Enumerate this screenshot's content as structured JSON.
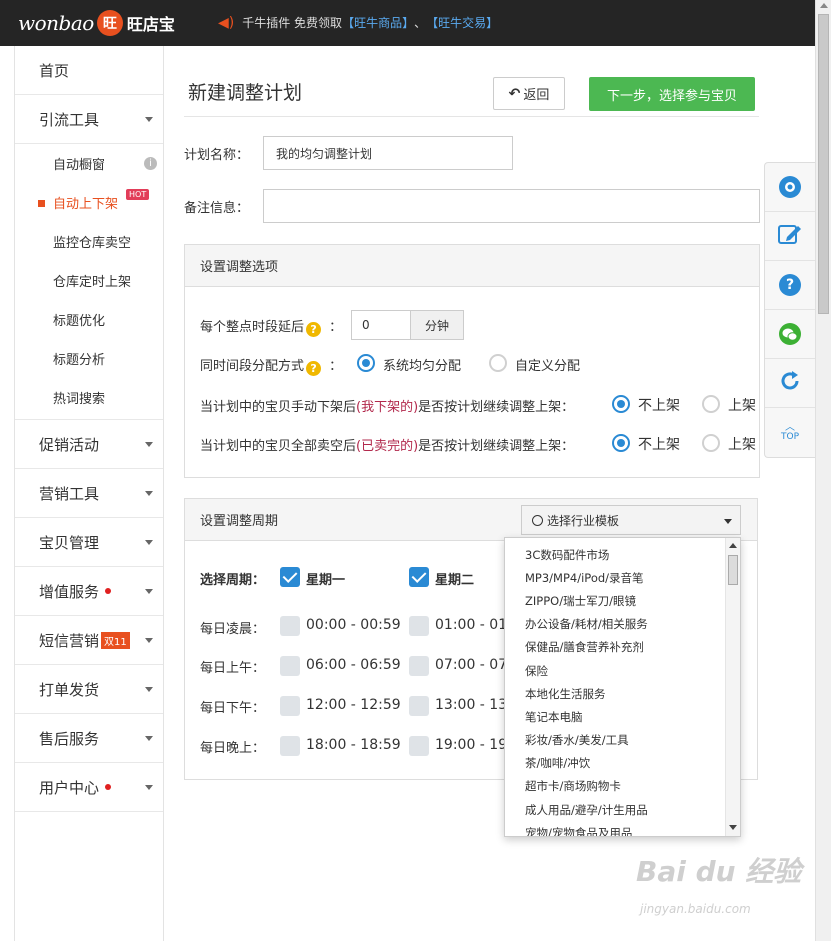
{
  "topbar": {
    "logo_text": "wonbao",
    "logo_badge": "旺",
    "logo_cn": "旺店宝",
    "notice_prefix": "千牛插件 免费领取",
    "link1": "【旺牛商品】",
    "sep": "、",
    "link2": "【旺牛交易】"
  },
  "sidebar": {
    "home": "首页",
    "traffic": "引流工具",
    "sub": [
      "自动橱窗",
      "自动上下架",
      "监控仓库卖空",
      "仓库定时上架",
      "标题优化",
      "标题分析",
      "热词搜索"
    ],
    "hot": "HOT",
    "promo": "促销活动",
    "marketing": "营销工具",
    "items": "宝贝管理",
    "value_added": "增值服务",
    "sms": "短信营销",
    "sms_badge": "双11",
    "print": "打单发货",
    "aftersale": "售后服务",
    "user": "用户中心"
  },
  "main": {
    "title": "新建调整计划",
    "back": "返回",
    "next": "下一步，选择参与宝贝",
    "plan_name_label": "计划名称：",
    "plan_name_value": "我的均匀调整计划",
    "note_label": "备注信息：",
    "note_value": ""
  },
  "options": {
    "head": "设置调整选项",
    "delay_label": "每个整点时段延后",
    "colon": "：",
    "delay_value": "0",
    "delay_unit": "分钟",
    "mode_label": "同时间段分配方式",
    "mode_a": "系统均匀分配",
    "mode_b": "自定义分配",
    "q1_pre": "当计划中的宝贝手动下架后",
    "q1_red": "(我下架的)",
    "q1_post": "是否按计划继续调整上架：",
    "q2_pre": "当计划中的宝贝全部卖空后",
    "q2_red": "(已卖完的)",
    "q2_post": "是否按计划继续调整上架：",
    "no": "不上架",
    "yes": "上架"
  },
  "cycle": {
    "head": "设置调整周期",
    "template_btn": "选择行业模板",
    "week_label": "选择周期：",
    "mon": "星期一",
    "tue": "星期二",
    "rows": [
      {
        "label": "每日凌晨：",
        "a": "00:00 - 00:59",
        "b": "01:00 - 01"
      },
      {
        "label": "每日上午：",
        "a": "06:00 - 06:59",
        "b": "07:00 - 07"
      },
      {
        "label": "每日下午：",
        "a": "12:00 - 12:59",
        "b": "13:00 - 13"
      },
      {
        "label": "每日晚上：",
        "a": "18:00 - 18:59",
        "b": "19:00 - 19"
      }
    ]
  },
  "dropdown": {
    "items": [
      "3C数码配件市场",
      "MP3/MP4/iPod/录音笔",
      "ZIPPO/瑞士军刀/眼镜",
      "办公设备/耗材/相关服务",
      "保健品/膳食营养补充剂",
      "保险",
      "本地化生活服务",
      "笔记本电脑",
      "彩妆/香水/美发/工具",
      "茶/咖啡/冲饮",
      "超市卡/商场购物卡",
      "成人用品/避孕/计生用品",
      "宠物/宠物食品及用品"
    ]
  },
  "floatbar": {
    "top": "TOP",
    "question": "?"
  },
  "watermark": {
    "text": "Bai du 经验",
    "url": "jingyan.baidu.com"
  },
  "colors": {
    "accent": "#e8501f",
    "primary": "#2a8ad4",
    "success": "#4cb852",
    "topbar": "#252525"
  }
}
